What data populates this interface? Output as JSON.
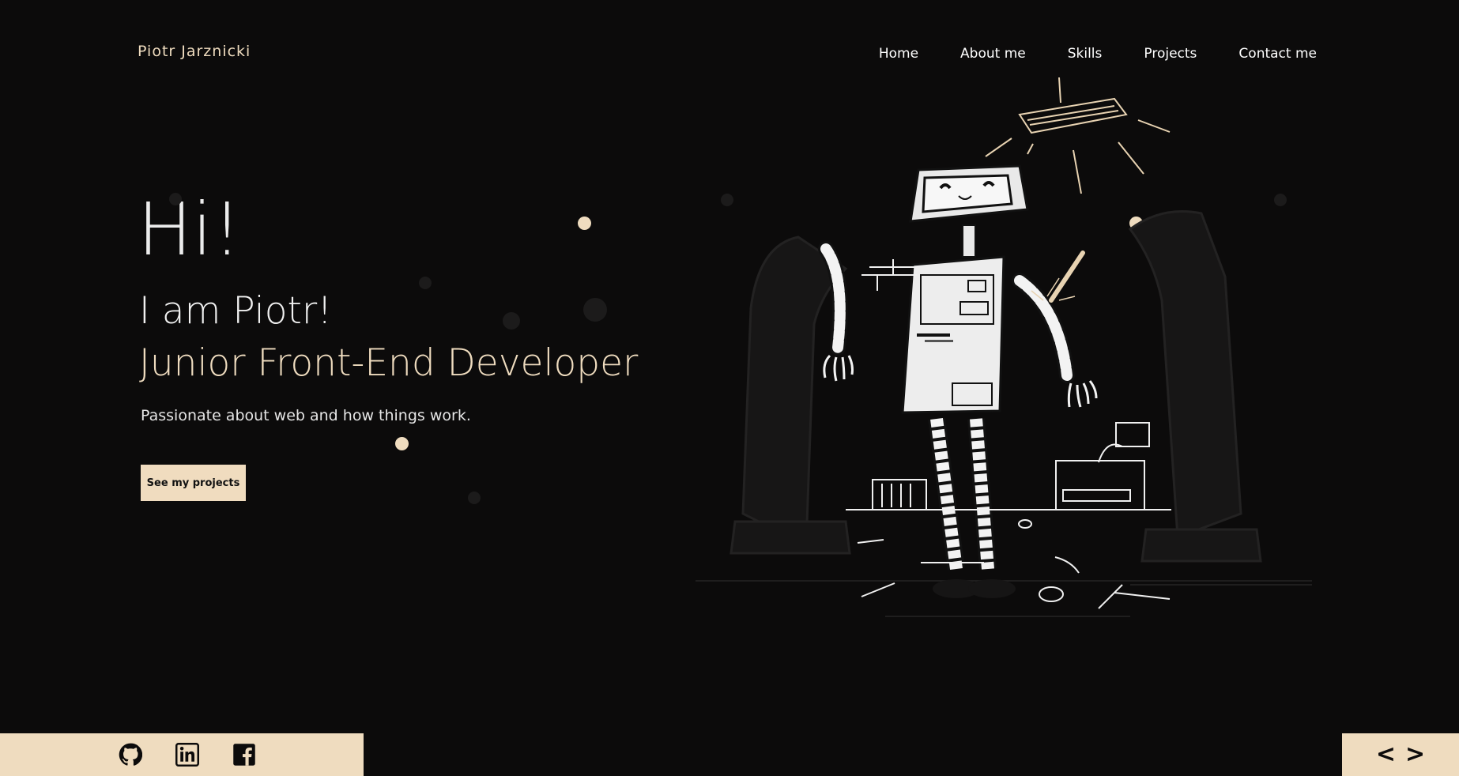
{
  "header": {
    "logo": "Piotr Jarznicki",
    "nav": [
      {
        "label": "Home"
      },
      {
        "label": "About me"
      },
      {
        "label": "Skills"
      },
      {
        "label": "Projects"
      },
      {
        "label": "Contact me"
      }
    ]
  },
  "hero": {
    "greeting": "Hi!",
    "name_line": "I am Piotr!",
    "role_line": "Junior Front-End Developer",
    "tagline": "Passionate about web and how things work.",
    "cta_label": "See my projects"
  },
  "social": {
    "icons": [
      "github-icon",
      "linkedin-icon",
      "facebook-icon"
    ]
  },
  "slider": {
    "prev_label": "<",
    "next_label": ">"
  },
  "colors": {
    "background": "#0c0b0b",
    "accent": "#efdcbf",
    "text": "#f2f2f2"
  }
}
